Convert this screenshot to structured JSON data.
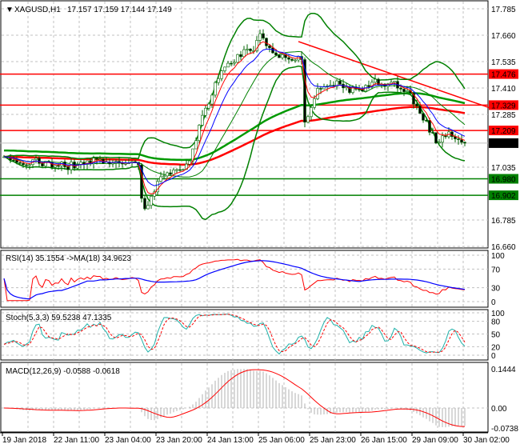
{
  "header": {
    "symbol": "XAGUSD,H1",
    "ohlc": "17.157 17.159 17.144 17.149"
  },
  "price_axis": {
    "ticks": [
      "17.785",
      "17.660",
      "17.535",
      "17.410",
      "17.285",
      "17.035",
      "16.785",
      "16.660"
    ],
    "tick_values": [
      17.785,
      17.66,
      17.535,
      17.41,
      17.285,
      17.035,
      16.785,
      16.66
    ],
    "current": {
      "label": "17.149",
      "value": 17.149,
      "color": "#000000"
    },
    "levels": [
      {
        "label": "17.476",
        "value": 17.476,
        "color": "#ff0000"
      },
      {
        "label": "17.329",
        "value": 17.329,
        "color": "#ff0000"
      },
      {
        "label": "17.209",
        "value": 17.209,
        "color": "#ff0000"
      },
      {
        "label": "16.980",
        "value": 16.98,
        "color": "#008000"
      },
      {
        "label": "16.902",
        "value": 16.902,
        "color": "#008000"
      }
    ],
    "trendline": {
      "from": [
        92,
        17.63
      ],
      "to": [
        152,
        17.315
      ],
      "color": "#ff0000"
    }
  },
  "time_axis": [
    "19 Jan 2018",
    "22 Jan 11:00",
    "23 Jan 04:00",
    "23 Jan 20:00",
    "24 Jan 13:00",
    "25 Jan 06:00",
    "25 Jan 23:00",
    "26 Jan 15:00",
    "29 Jan 09:00",
    "30 Jan 02:00"
  ],
  "rsi": {
    "title": "RSI(14) 35.1554  ->MA(18) 34.9623",
    "ticks": [
      "100",
      "70",
      "30",
      "0"
    ],
    "tick_values": [
      100,
      70,
      30,
      0
    ]
  },
  "stoch": {
    "title": "Stoch(5,3,3) 59.5238 47.1335",
    "ticks": [
      "100",
      "80",
      "50",
      "20",
      "0"
    ],
    "tick_values": [
      100,
      80,
      50,
      20,
      0
    ]
  },
  "macd": {
    "title": "MACD(12,26,9) -0.0588 -0.0618",
    "ticks": [
      "0.1444",
      "0.00",
      "-0.0738"
    ],
    "tick_values": [
      0.1444,
      0,
      -0.0738
    ]
  },
  "chart_data": {
    "type": "line",
    "title": "XAGUSD,H1",
    "ylim": [
      16.66,
      17.785
    ],
    "price_path": [
      [
        0,
        17.07
      ],
      [
        10,
        17.06
      ],
      [
        20,
        17.04
      ],
      [
        30,
        17.07
      ],
      [
        40,
        17.05
      ],
      [
        42,
        17.04
      ],
      [
        43,
        16.88
      ],
      [
        44,
        16.83
      ],
      [
        46,
        16.9
      ],
      [
        48,
        16.97
      ],
      [
        55,
        17.02
      ],
      [
        58,
        17.05
      ],
      [
        61,
        17.22
      ],
      [
        64,
        17.35
      ],
      [
        66,
        17.43
      ],
      [
        70,
        17.52
      ],
      [
        74,
        17.57
      ],
      [
        78,
        17.6
      ],
      [
        80,
        17.66
      ],
      [
        84,
        17.58
      ],
      [
        88,
        17.56
      ],
      [
        92,
        17.55
      ],
      [
        93,
        17.56
      ],
      [
        94,
        17.25
      ],
      [
        96,
        17.32
      ],
      [
        98,
        17.4
      ],
      [
        104,
        17.44
      ],
      [
        108,
        17.4
      ],
      [
        112,
        17.4
      ],
      [
        116,
        17.44
      ],
      [
        122,
        17.43
      ],
      [
        127,
        17.37
      ],
      [
        132,
        17.24
      ],
      [
        135,
        17.16
      ],
      [
        138,
        17.19
      ],
      [
        142,
        17.17
      ],
      [
        144,
        17.149
      ]
    ],
    "colors": {
      "bars": "#006400",
      "bands": "#008000",
      "ma_fast": "#ff0000",
      "ma_slow": "#0000ff",
      "ma_long_green": "#009900",
      "ma_long_red": "#ff0000"
    }
  }
}
